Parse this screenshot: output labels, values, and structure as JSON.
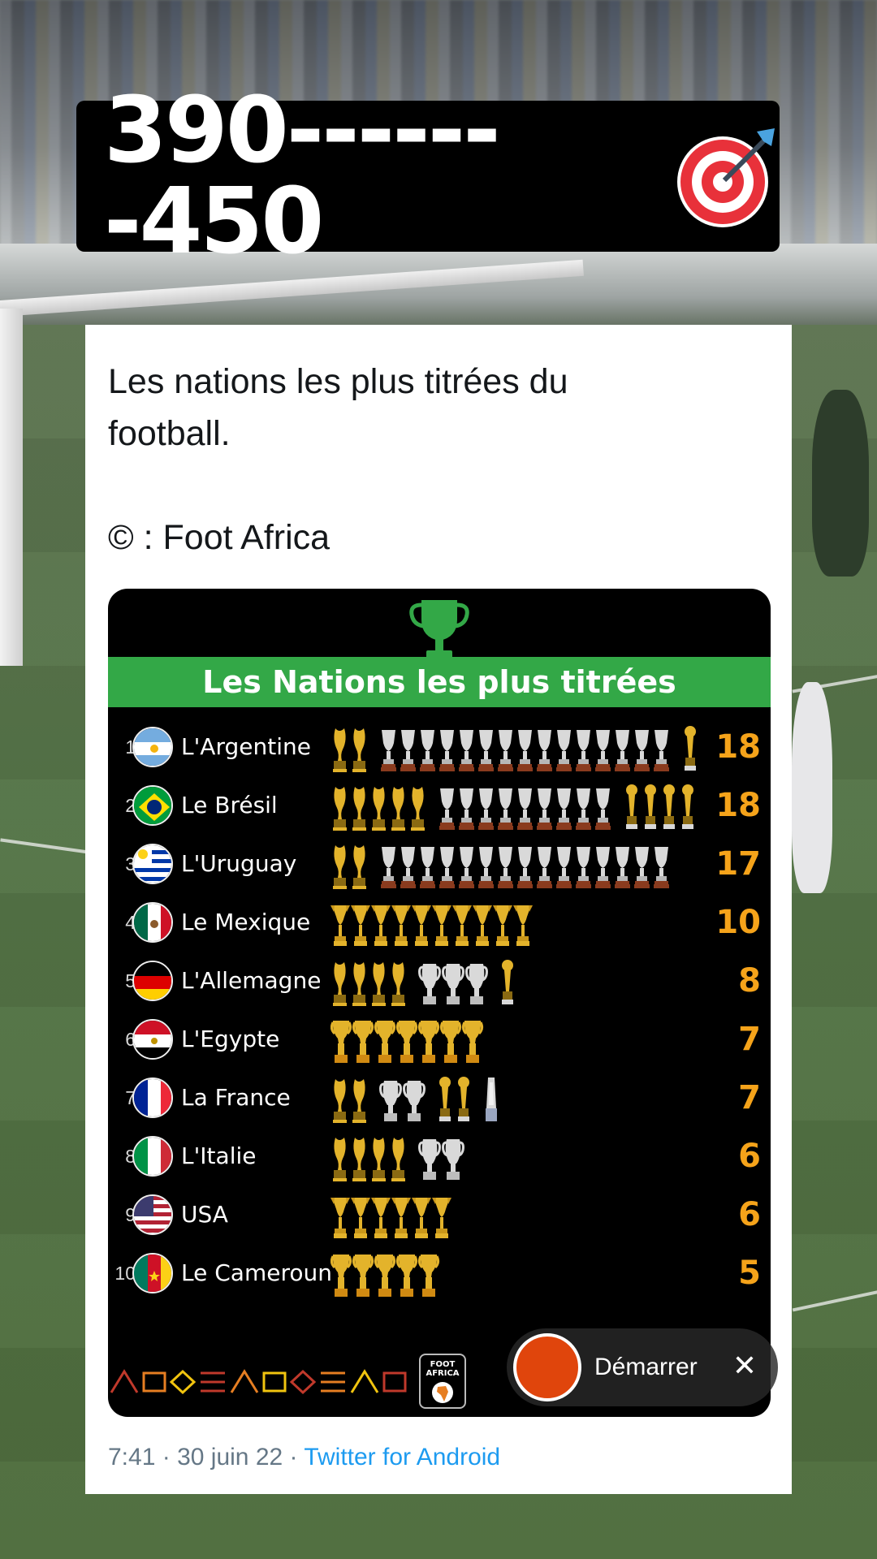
{
  "banner": {
    "text": "390-------450",
    "icon": "direct-hit-icon"
  },
  "tweet": {
    "text_lines": [
      "Les nations les plus titrées du",
      "football."
    ],
    "credit": "© : Foot Africa",
    "time": "7:41",
    "date": "30 juin 22",
    "source": "Twitter for Android",
    "separator": "·"
  },
  "infographic": {
    "title": "Les Nations les plus titrées",
    "logo_text": [
      "FOOT",
      "AFRICA"
    ],
    "colors": {
      "title_bar": "#33a847",
      "count": "#f5a31a",
      "gold": "#e3b32b",
      "silver": "#d9d9d9"
    }
  },
  "chart_data": {
    "type": "table",
    "title": "Les Nations les plus titrées",
    "columns": [
      "rank",
      "country",
      "titles"
    ],
    "rows": [
      {
        "rank": "1",
        "country": "L'Argentine",
        "titles": 18,
        "flag": "argentina"
      },
      {
        "rank": "2",
        "country": "Le Brésil",
        "titles": 18,
        "flag": "brazil"
      },
      {
        "rank": "3",
        "country": "L'Uruguay",
        "titles": 17,
        "flag": "uruguay"
      },
      {
        "rank": "4",
        "country": "Le Mexique",
        "titles": 10,
        "flag": "mexico"
      },
      {
        "rank": "5",
        "country": "L'Allemagne",
        "titles": 8,
        "flag": "germany"
      },
      {
        "rank": "6",
        "country": "L'Egypte",
        "titles": 7,
        "flag": "egypt"
      },
      {
        "rank": "7",
        "country": "La France",
        "titles": 7,
        "flag": "france"
      },
      {
        "rank": "8",
        "country": "L'Italie",
        "titles": 6,
        "flag": "italy"
      },
      {
        "rank": "9",
        "country": "USA",
        "titles": 6,
        "flag": "usa"
      },
      {
        "rank": "10",
        "country": "Le Cameroun",
        "titles": 5,
        "flag": "cameroon"
      }
    ],
    "trophy_groups": [
      [
        [
          "world-cup",
          2
        ],
        [
          "copa-america",
          15
        ],
        [
          "confederations-cup",
          1
        ]
      ],
      [
        [
          "world-cup",
          5
        ],
        [
          "copa-america",
          9
        ],
        [
          "confederations-cup",
          4
        ]
      ],
      [
        [
          "world-cup",
          2
        ],
        [
          "copa-america",
          15
        ]
      ],
      [
        [
          "gold-cup",
          10
        ]
      ],
      [
        [
          "world-cup",
          4
        ],
        [
          "euro",
          3
        ],
        [
          "confederations-cup",
          1
        ]
      ],
      [
        [
          "afcon",
          7
        ]
      ],
      [
        [
          "world-cup",
          2
        ],
        [
          "euro",
          2
        ],
        [
          "confederations-cup",
          2
        ],
        [
          "nations-league",
          1
        ]
      ],
      [
        [
          "world-cup",
          4
        ],
        [
          "euro",
          2
        ]
      ],
      [
        [
          "gold-cup",
          6
        ]
      ],
      [
        [
          "afcon",
          5
        ]
      ]
    ]
  },
  "recorder": {
    "label": "Démarrer",
    "close": "✕"
  }
}
